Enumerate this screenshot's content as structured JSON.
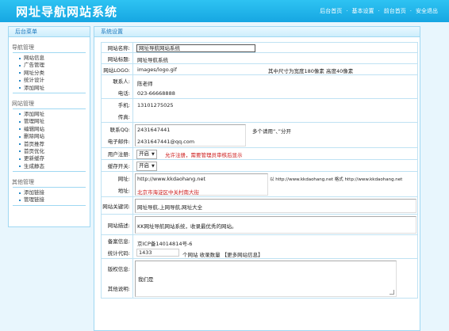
{
  "header": {
    "title": "网址导航网站系统",
    "links": [
      "后台首页",
      "基本设置",
      "前台首页",
      "安全退出"
    ]
  },
  "sidebar": {
    "title": "后台菜单",
    "groups": [
      {
        "title": "导航管理",
        "items": [
          "网站信息",
          "广告管理",
          "网址分类",
          "统计设计",
          "添加网址"
        ]
      },
      {
        "title": "网站管理",
        "items": [
          "添加网址",
          "管理网址",
          "编辑网站",
          "删除网站",
          "首页推荐",
          "首页优化",
          "更新缓存",
          "生成静态"
        ]
      },
      {
        "title": "其他管理",
        "items": [
          "添加链接",
          "管理链接"
        ]
      }
    ]
  },
  "main": {
    "title": "系统设置",
    "fields": {
      "site_name": {
        "label": "网站名称:",
        "value": "网址导航网站系统"
      },
      "site_title": {
        "label": "网站标题:",
        "value": "网址导航系统"
      },
      "logo": {
        "label": "网站LOGO:",
        "value": "images/logo.gif",
        "note": "其中尺寸为宽度180像素 高度40像素"
      },
      "contact": {
        "label": "联系人:",
        "value": "陈老师"
      },
      "phone": {
        "label": "电话:",
        "value": "023-66668888"
      },
      "mobile": {
        "label": "手机:",
        "value": "13101275025"
      },
      "fax": {
        "label": "传真:",
        "value": ""
      },
      "qq": {
        "label": "联系QQ:",
        "value": "2431647441",
        "note": "多个请用“、”分开"
      },
      "email": {
        "label": "电子邮件:",
        "value": "2431647441@qq.com"
      },
      "register": {
        "label": "用户注册:",
        "value": "开启",
        "note": "允许注册，需要管理员审核后显示"
      },
      "cache": {
        "label": "缓存开关:",
        "value": "开启"
      },
      "url": {
        "label": "网址:",
        "value": "http://www.kkdaohang.net",
        "note": "以 http://www.kkdaohang.net 格式 http://www.kkdaohang.net"
      },
      "address": {
        "label": "地址:",
        "value": "北京市海淀区中关村南大街"
      },
      "keywords": {
        "label": "网站关键词:",
        "value": "网址导航,上网导航,网址大全"
      },
      "description": {
        "label": "网站描述:",
        "value": "KK网址导航网站系统，收录最优秀的网站。"
      },
      "icp": {
        "label": "备案信息:",
        "value": "京ICP备14014814号-6"
      },
      "count": {
        "label": "统计代码:",
        "value": "1433",
        "note": "个网站 收录数量 【更多网站信息】"
      },
      "copyright": {
        "label": "版权信息:",
        "value": ""
      },
      "remark": {
        "label": "其他说明:",
        "value": "我们是"
      }
    }
  }
}
